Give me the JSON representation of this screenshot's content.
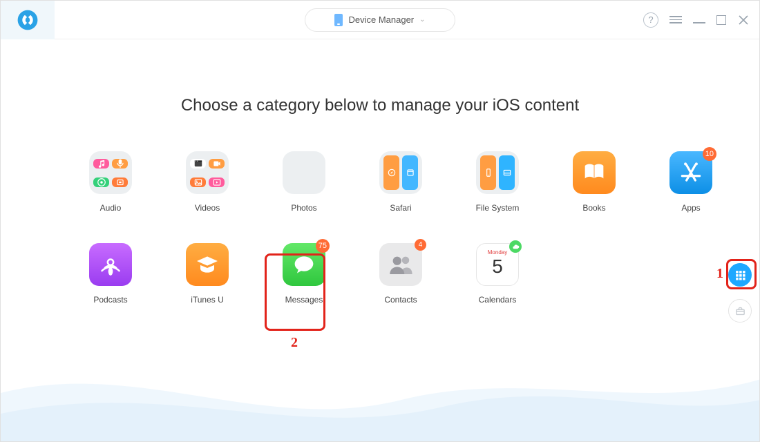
{
  "header": {
    "dropdown_label": "Device Manager"
  },
  "title": "Choose a category below to manage your iOS content",
  "categories": [
    {
      "key": "audio",
      "label": "Audio"
    },
    {
      "key": "videos",
      "label": "Videos"
    },
    {
      "key": "photos",
      "label": "Photos"
    },
    {
      "key": "safari",
      "label": "Safari"
    },
    {
      "key": "filesystem",
      "label": "File System"
    },
    {
      "key": "books",
      "label": "Books"
    },
    {
      "key": "apps",
      "label": "Apps",
      "badge": "10"
    },
    {
      "key": "podcasts",
      "label": "Podcasts"
    },
    {
      "key": "itunesu",
      "label": "iTunes U"
    },
    {
      "key": "messages",
      "label": "Messages",
      "badge": "75"
    },
    {
      "key": "contacts",
      "label": "Contacts",
      "badge": "4"
    },
    {
      "key": "calendars",
      "label": "Calendars",
      "cloud": true,
      "weekday": "Monday",
      "day": "5"
    }
  ],
  "annotations": {
    "step1": "1",
    "step2": "2"
  }
}
